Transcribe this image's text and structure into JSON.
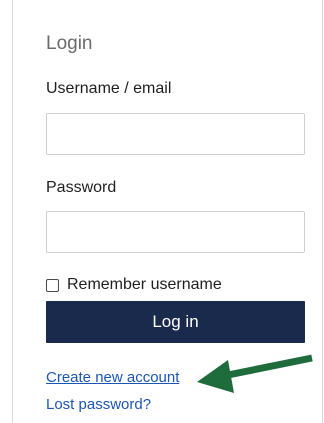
{
  "login": {
    "title": "Login",
    "username_label": "Username / email",
    "username_value": "",
    "password_label": "Password",
    "password_value": "",
    "remember_label": "Remember username",
    "remember_checked": false,
    "login_button": "Log in",
    "create_account_link": "Create new account",
    "lost_password_link": "Lost password?"
  },
  "annotation": {
    "arrow_color": "#1e6b3c",
    "arrow_icon": "arrow-left-icon"
  },
  "colors": {
    "button_bg": "#1a2a4d",
    "link": "#1c56b3"
  }
}
